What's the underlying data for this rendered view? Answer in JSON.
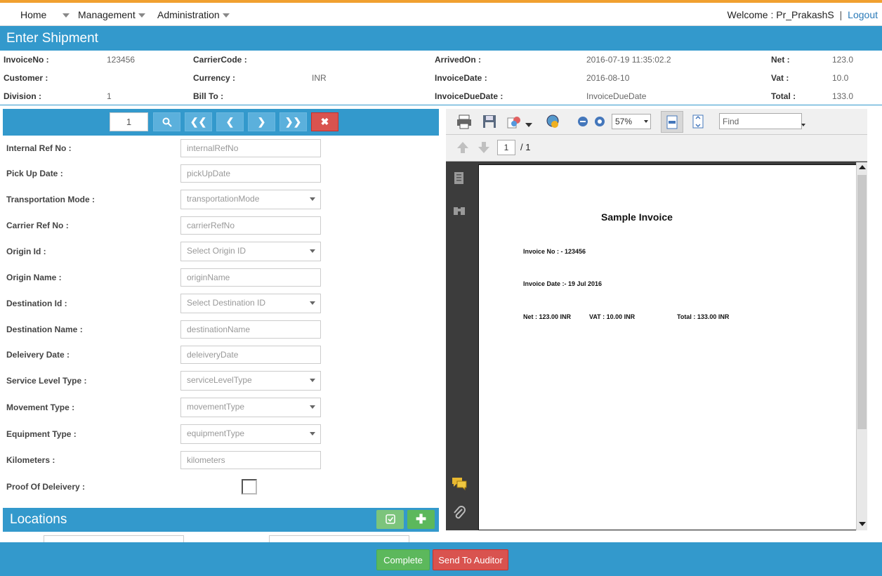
{
  "nav": {
    "home": "Home",
    "management": "Management",
    "administration": "Administration",
    "welcome": "Welcome : Pr_PrakashS",
    "separator": "|",
    "logout": "Logout"
  },
  "page_title": "Enter Shipment",
  "summary": {
    "invoice_no_label": "InvoiceNo :",
    "invoice_no": "123456",
    "carrier_code_label": "CarrierCode :",
    "carrier_code": "",
    "arrived_on_label": "ArrivedOn :",
    "arrived_on": "2016-07-19 11:35:02.2",
    "net_label": "Net :",
    "net": "123.0",
    "customer_label": "Customer :",
    "customer": "",
    "currency_label": "Currency :",
    "currency": "INR",
    "invoice_date_label": "InvoiceDate :",
    "invoice_date": "2016-08-10",
    "vat_label": "Vat :",
    "vat": "10.0",
    "division_label": "Division :",
    "division": "1",
    "bill_to_label": "Bill To :",
    "bill_to": "",
    "invoice_due_date_label": "InvoiceDueDate :",
    "invoice_due_date": "InvoiceDueDate",
    "total_label": "Total :",
    "total": "133.0"
  },
  "pager": {
    "page": "1"
  },
  "form": {
    "internal_ref_no": {
      "label": "Internal Ref No :",
      "placeholder": "internalRefNo"
    },
    "pick_up_date": {
      "label": "Pick Up Date :",
      "placeholder": "pickUpDate"
    },
    "transportation_mode": {
      "label": "Transportation Mode :",
      "placeholder": "transportationMode"
    },
    "carrier_ref_no": {
      "label": "Carrier Ref No :",
      "placeholder": "carrierRefNo"
    },
    "origin_id": {
      "label": "Origin Id :",
      "placeholder": "Select Origin ID"
    },
    "origin_name": {
      "label": "Origin Name :",
      "placeholder": "originName"
    },
    "destination_id": {
      "label": "Destination Id :",
      "placeholder": "Select Destination ID"
    },
    "destination_name": {
      "label": "Destination Name :",
      "placeholder": "destinationName"
    },
    "delivery_date": {
      "label": "Deleivery Date :",
      "placeholder": "deleiveryDate"
    },
    "service_level_type": {
      "label": "Service Level Type :",
      "placeholder": "serviceLevelType"
    },
    "movement_type": {
      "label": "Movement Type :",
      "placeholder": "movementType"
    },
    "equipment_type": {
      "label": "Equipment Type :",
      "placeholder": "equipmentType"
    },
    "kilometers": {
      "label": "Kilometers :",
      "placeholder": "kilometers"
    },
    "proof_of_delivery": {
      "label": "Proof Of Deleivery :",
      "checked": false
    }
  },
  "locations": {
    "title": "Locations"
  },
  "pdf": {
    "zoom": "57%",
    "find_placeholder": "Find",
    "page_input": "1",
    "page_total": "/ 1",
    "doc": {
      "title": "Sample Invoice",
      "invoice_no": "Invoice No : - 123456",
      "invoice_date": "Invoice Date :- 19 Jul 2016",
      "net": "Net : 123.00 INR",
      "vat": "VAT : 10.00 INR",
      "total": "Total : 133.00 INR"
    }
  },
  "footer": {
    "complete": "Complete",
    "send_to_auditor": "Send To Auditor"
  },
  "colors": {
    "primary": "#3399cc",
    "success": "#5cb85c",
    "danger": "#d9534f",
    "accent": "#f0a030"
  }
}
